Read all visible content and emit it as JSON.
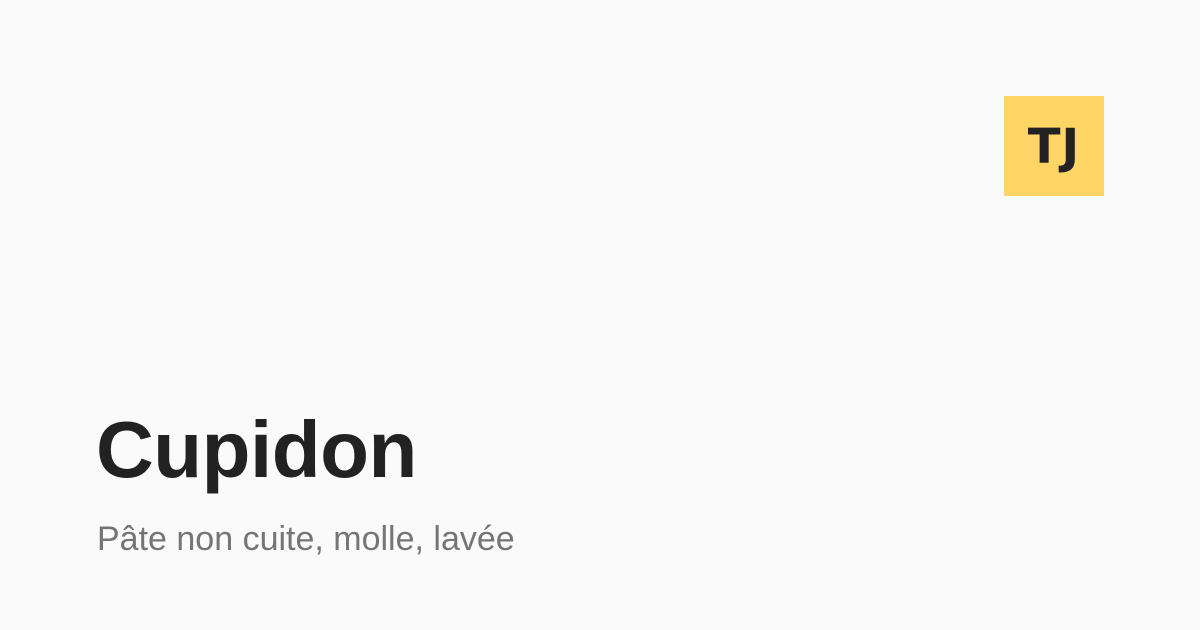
{
  "logo": {
    "text": "TJ",
    "background_color": "#ffd666",
    "text_color": "#222222"
  },
  "title": "Cupidon",
  "subtitle": "Pâte non cuite, molle, lavée",
  "colors": {
    "background": "#fafafa",
    "title": "#222222",
    "subtitle": "#757575"
  }
}
